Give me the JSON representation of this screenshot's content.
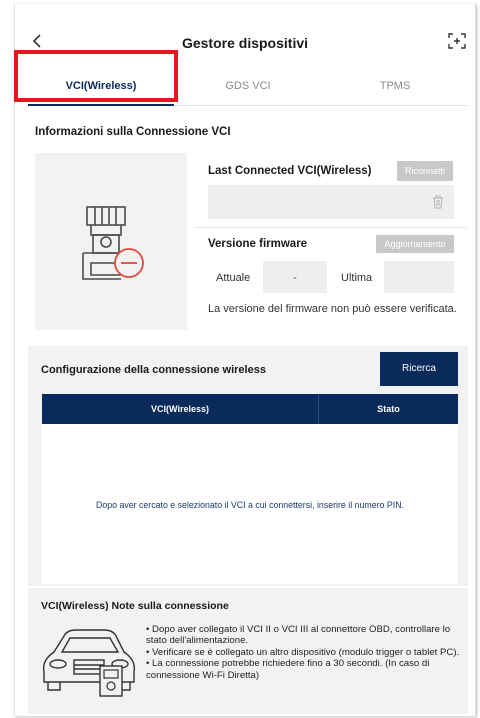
{
  "header": {
    "back_icon": "chevron-left-icon",
    "title": "Gestore dispositivi",
    "expand_icon": "expand-icon"
  },
  "tabs": [
    {
      "label": "VCI(Wireless)",
      "active": true
    },
    {
      "label": "GDS VCI",
      "active": false
    },
    {
      "label": "TPMS",
      "active": false
    }
  ],
  "connection_info": {
    "title": "Informazioni sulla Connessione VCI",
    "device_icon": "vci-device-disconnected-icon",
    "last_connected_label": "Last Connected VCI(Wireless)",
    "reconnect_label": "Riconnetti",
    "trash_icon": "trash-icon",
    "firmware_label": "Versione firmware",
    "update_label": "Aggiornamento",
    "current_label": "Attuale",
    "current_value": "-",
    "latest_label": "Ultima",
    "latest_value": "",
    "firmware_message": "La versione del firmware non può essere verificata."
  },
  "wireless": {
    "title": "Configurazione della connessione wireless",
    "search_label": "Ricerca",
    "columns": [
      "VCI(Wireless)",
      "Stato"
    ],
    "empty_message": "Dopo aver cercato e selezionato il VCI a cui connettersi, inserire il numero PIN."
  },
  "notes": {
    "title": "VCI(Wireless) Note sulla connessione",
    "illustration_icon": "car-obd-illustration-icon",
    "lines": [
      "• Dopo aver collegato il VCI II o VCI III al connettore OBD, controllare lo stato dell'alimentazione.",
      "• Verificare se è collegato un altro dispositivo (modulo trigger o tablet PC).",
      "• La connessione potrebbe richiedere fino a 30 secondi. (In caso di connessione Wi-Fi Diretta)"
    ]
  },
  "colors": {
    "navy": "#0b2a5c",
    "highlight_red": "#e8141e",
    "panel_gray": "#f3f1f1",
    "disabled_button": "#c8c8c8",
    "status_red": "#e04a3a"
  }
}
